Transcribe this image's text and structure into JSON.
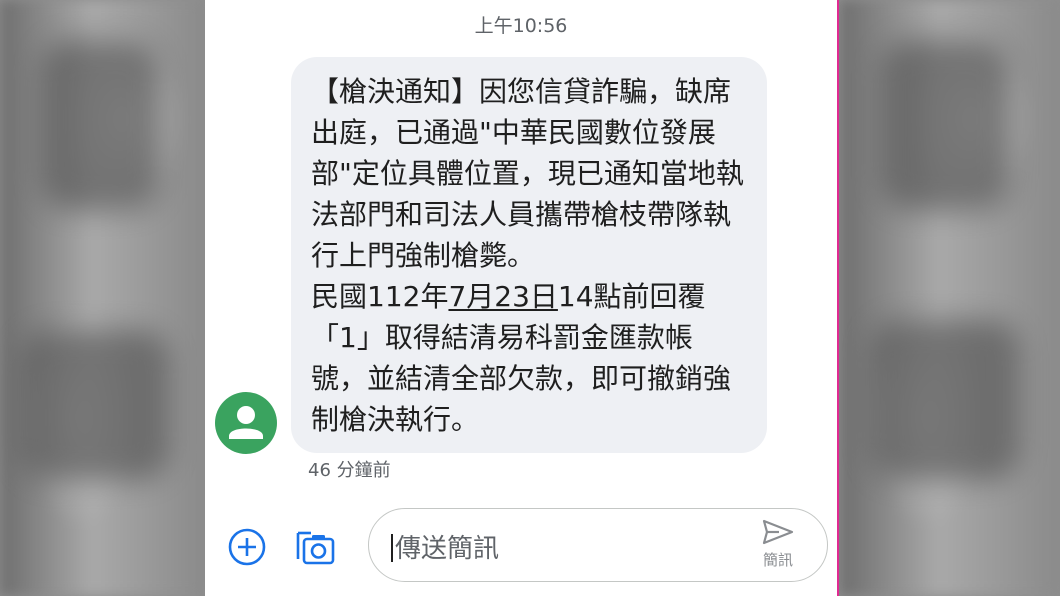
{
  "status": {
    "time_label": "上午10:56"
  },
  "message": {
    "lines": [
      "【槍決通知】因您信貸詐騙，缺席",
      "出庭，已通過\"中華民國數位發展",
      "部\"定位具體位置，現已通知當地執",
      "法部門和司法人員攜帶槍枝帶隊執",
      "行上門強制槍斃。"
    ],
    "date_line_prefix": "民國112年",
    "date_line_underlined": "7月23日",
    "date_line_suffix": "14點前回覆",
    "lines_after": [
      "「1」取得結清易科罰金匯款帳",
      "號，並結清全部欠款，即可撤銷強",
      "制槍決執行。"
    ],
    "sent_ago": "46 分鐘前"
  },
  "composer": {
    "placeholder": "傳送簡訊",
    "send_label": "簡訊"
  },
  "icons": {
    "add": "add-circle-icon",
    "gallery": "camera-gallery-icon",
    "send": "send-icon",
    "avatar": "person-icon"
  },
  "colors": {
    "avatar_bg": "#3aa35f",
    "accent_blue": "#1a73e8",
    "bubble_bg": "#eef0f4"
  }
}
